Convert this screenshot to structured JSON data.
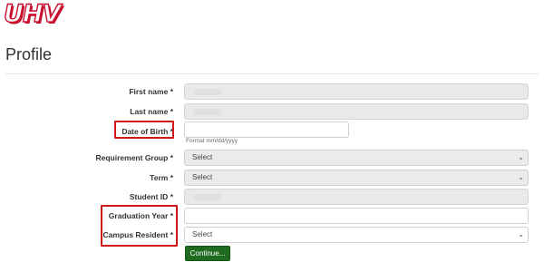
{
  "brand": {
    "logo_text": "UHV"
  },
  "page": {
    "title": "Profile"
  },
  "form": {
    "first_name": {
      "label": "First name",
      "required": "*"
    },
    "last_name": {
      "label": "Last name",
      "required": "*"
    },
    "dob": {
      "label": "Date of Birth",
      "required": "*",
      "hint": "Format mm/dd/yyyy"
    },
    "requirement_group": {
      "label": "Requirement Group",
      "required": "*",
      "value": "Select"
    },
    "term": {
      "label": "Term",
      "required": "*",
      "value": "Select"
    },
    "student_id": {
      "label": "Student ID",
      "required": "*"
    },
    "graduation_year": {
      "label": "Graduation Year",
      "required": "*"
    },
    "campus_resident": {
      "label": "Campus Resident",
      "required": "*",
      "value": "Select"
    }
  },
  "actions": {
    "continue_label": "Continue..."
  },
  "icons": {
    "select_arrow": "chevron-down-icon"
  },
  "colors": {
    "highlight": "#d01717",
    "button": "#1f6b1f",
    "brand": "#c8102e"
  }
}
